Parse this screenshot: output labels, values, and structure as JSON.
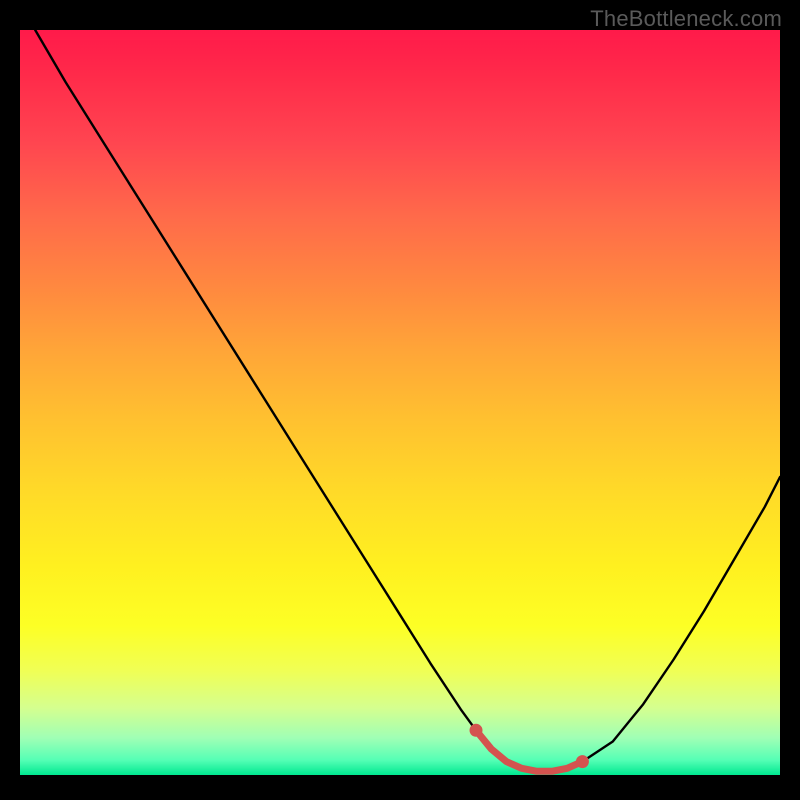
{
  "watermark": "TheBottleneck.com",
  "chart_data": {
    "type": "line",
    "title": "",
    "xlabel": "",
    "ylabel": "",
    "xlim": [
      0,
      100
    ],
    "ylim": [
      0,
      100
    ],
    "series": [
      {
        "name": "bottleneck-curve",
        "x": [
          2,
          6,
          10,
          14,
          18,
          22,
          26,
          30,
          34,
          38,
          42,
          46,
          50,
          54,
          58,
          60,
          62,
          64,
          66,
          68,
          70,
          72,
          74,
          78,
          82,
          86,
          90,
          94,
          98,
          100
        ],
        "values": [
          100,
          93,
          86.5,
          80,
          73.5,
          67,
          60.5,
          54,
          47.5,
          41,
          34.5,
          28,
          21.5,
          15,
          8.8,
          6,
          3.5,
          1.8,
          0.9,
          0.5,
          0.5,
          0.9,
          1.8,
          4.5,
          9.5,
          15.5,
          22,
          29,
          36,
          40
        ]
      }
    ],
    "markers": {
      "name": "optimal-range",
      "color": "#d4534f",
      "x": [
        60,
        62,
        64,
        66,
        68,
        70,
        72,
        74
      ],
      "values": [
        6,
        3.5,
        1.8,
        0.9,
        0.5,
        0.5,
        0.9,
        1.8
      ]
    },
    "background_gradient": {
      "top": "#ff1a4a",
      "mid": "#fff020",
      "bottom": "#00e890"
    }
  }
}
